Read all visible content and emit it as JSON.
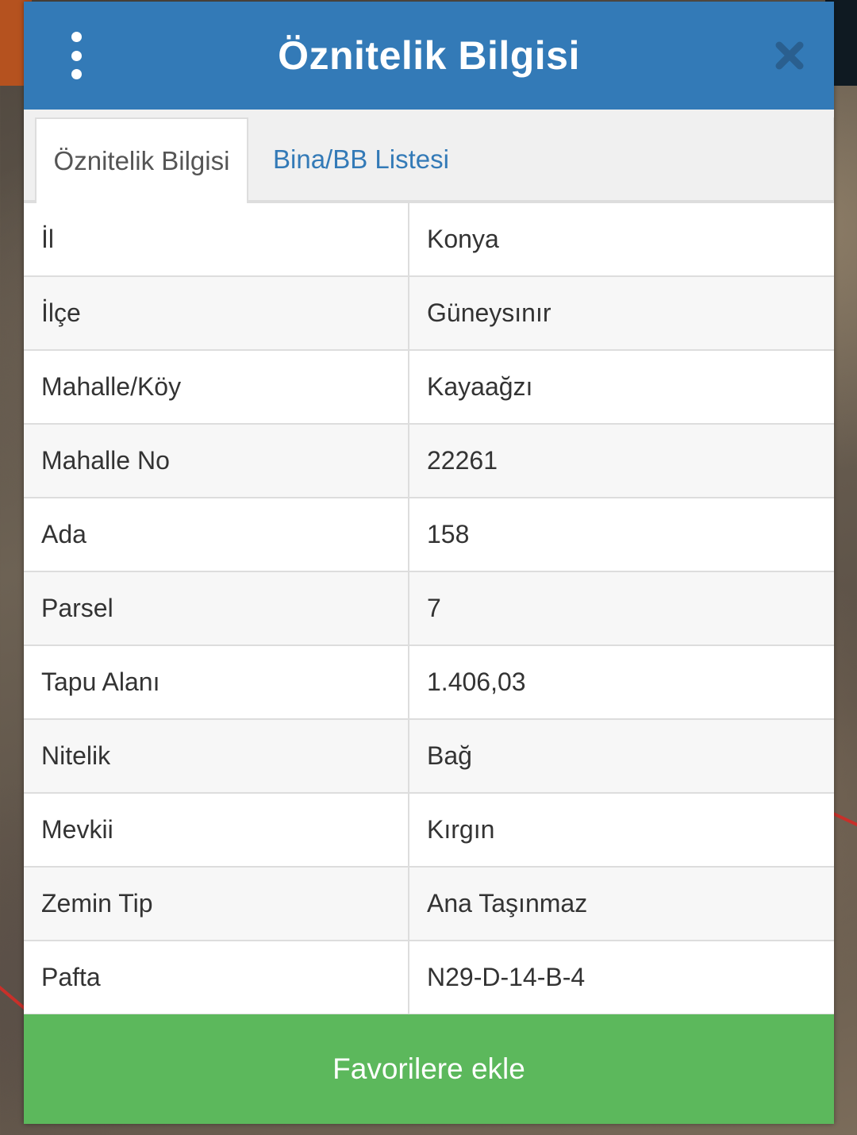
{
  "header": {
    "title": "Öznitelik Bilgisi"
  },
  "tabs": [
    {
      "label": "Öznitelik Bilgisi",
      "active": true
    },
    {
      "label": "Bina/BB Listesi",
      "active": false
    }
  ],
  "attributes": [
    {
      "key": "İl",
      "value": "Konya"
    },
    {
      "key": "İlçe",
      "value": "Güneysınır"
    },
    {
      "key": "Mahalle/Köy",
      "value": "Kayaağzı"
    },
    {
      "key": "Mahalle No",
      "value": "22261"
    },
    {
      "key": "Ada",
      "value": "158"
    },
    {
      "key": "Parsel",
      "value": "7"
    },
    {
      "key": "Tapu Alanı",
      "value": "1.406,03"
    },
    {
      "key": "Nitelik",
      "value": "Bağ"
    },
    {
      "key": "Mevkii",
      "value": "Kırgın"
    },
    {
      "key": "Zemin Tip",
      "value": "Ana Taşınmaz"
    },
    {
      "key": "Pafta",
      "value": "N29-D-14-B-4"
    }
  ],
  "footer": {
    "favorite_label": "Favorilere ekle"
  },
  "colors": {
    "header_bg": "#337ab7",
    "footer_bg": "#5cb85c",
    "tab_link": "#337ab7",
    "close_icon": "#2a5f8f"
  },
  "icons": {
    "menu": "kebab-menu-icon",
    "close": "close-icon"
  }
}
